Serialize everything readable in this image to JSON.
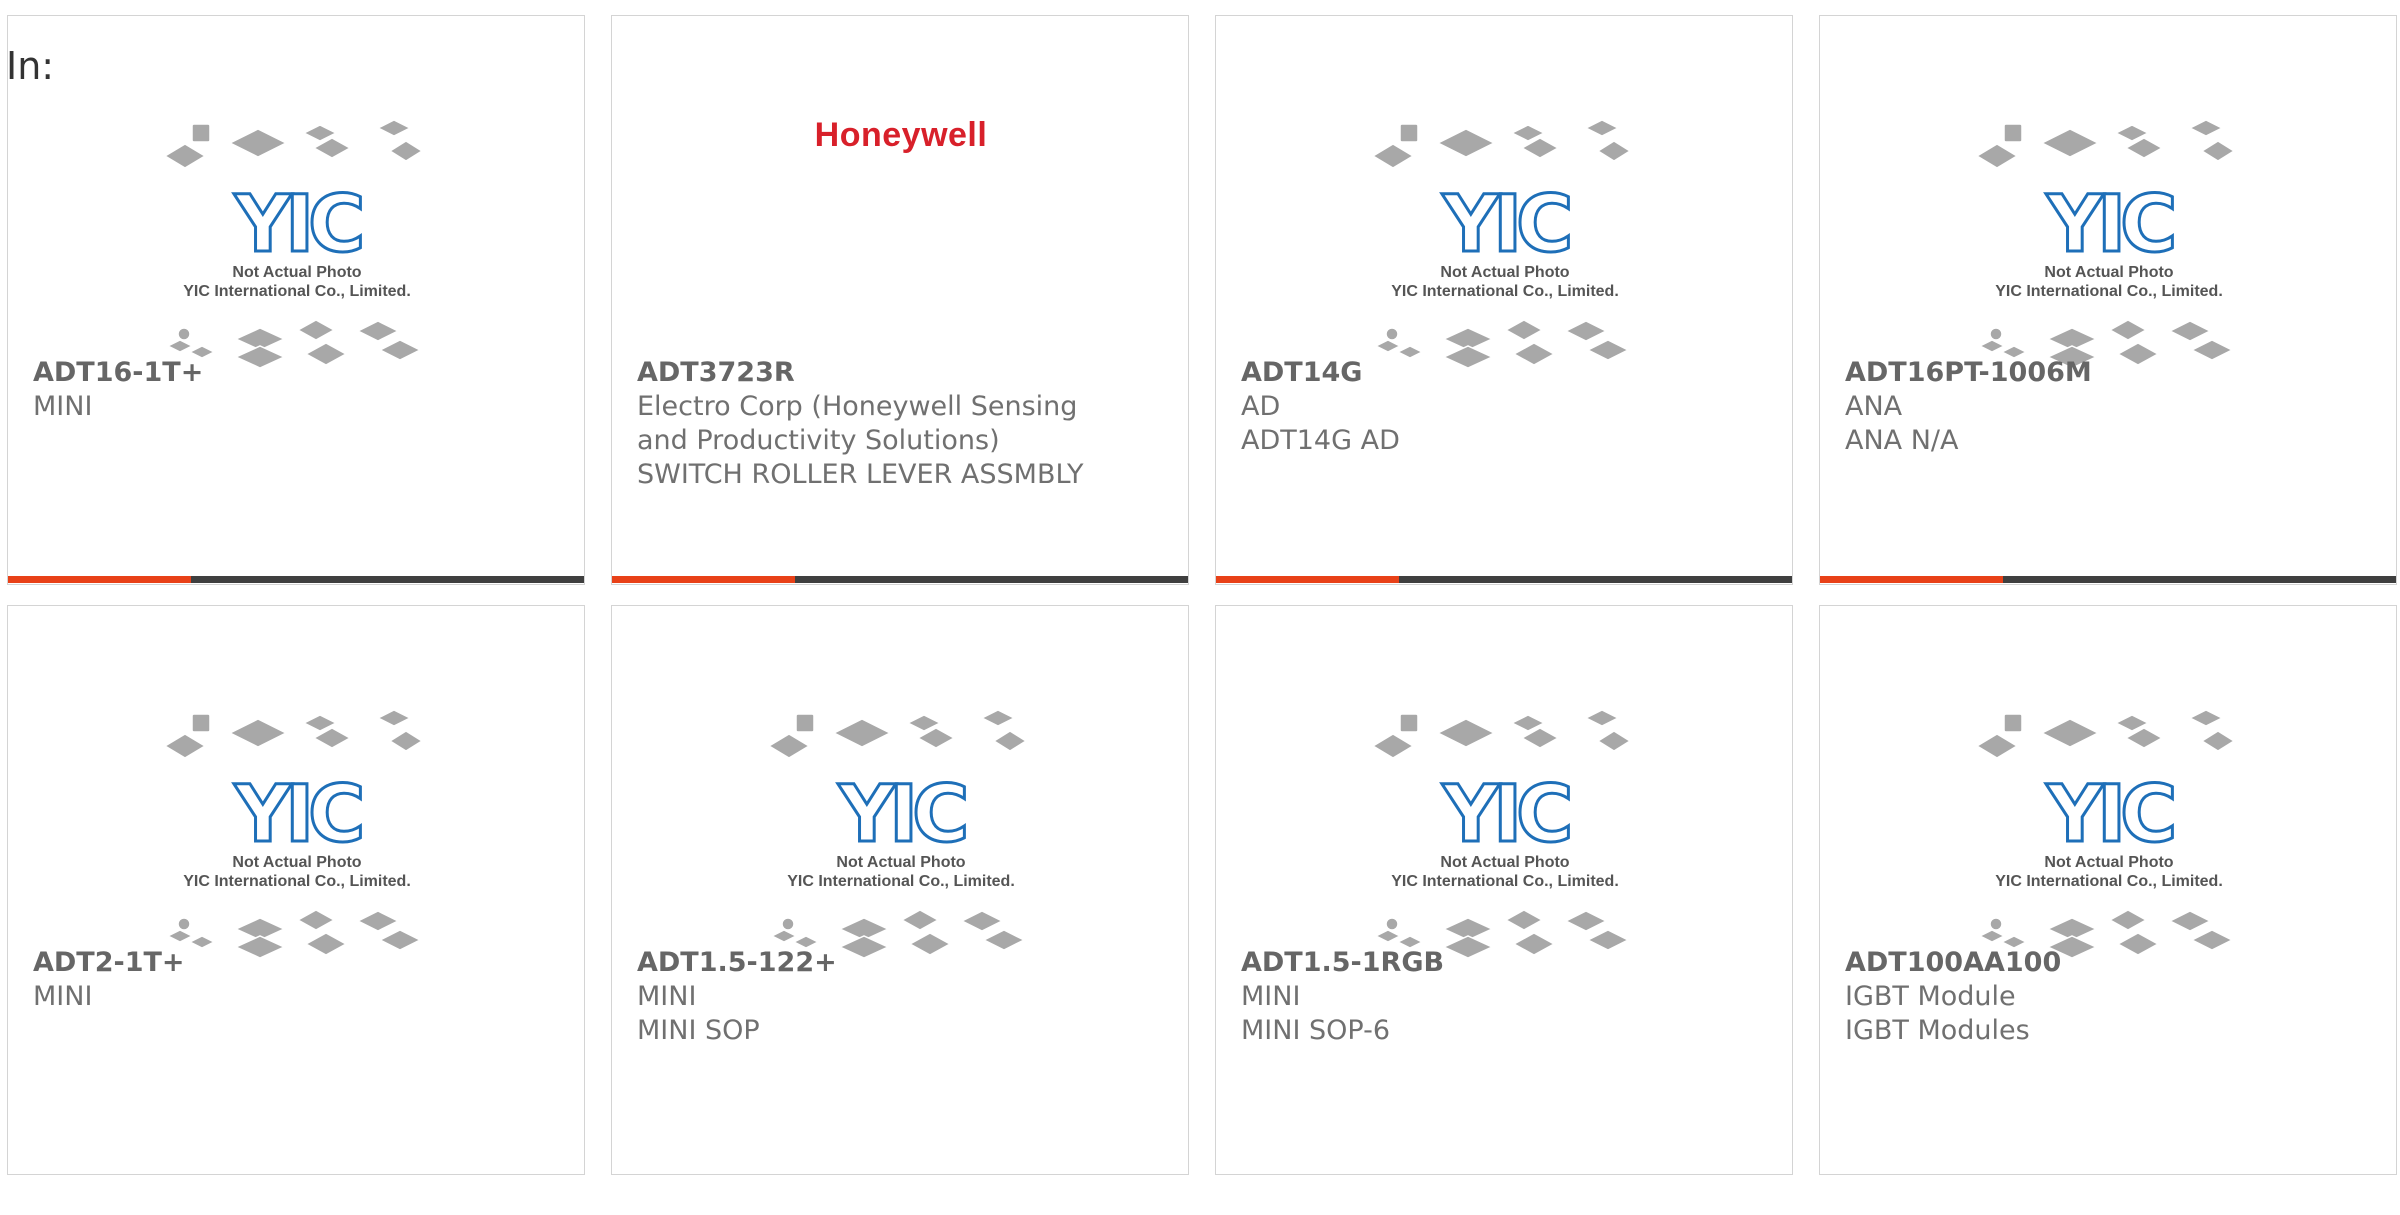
{
  "prefix_label": "In:",
  "placeholder_image": {
    "caption_line1": "Not Actual Photo",
    "caption_line2": "YIC International Co., Limited.",
    "logo_text": "YIC",
    "logo_color": "#1e6fb8",
    "chip_color": "#a8a8a8"
  },
  "accent_color": "#e84118",
  "bar_color": "#3f3f3f",
  "products": [
    {
      "part_number": "ADT16-1T+",
      "lines": [
        "MINI"
      ],
      "image": "placeholder"
    },
    {
      "part_number": "ADT3723R",
      "lines": [
        "Electro Corp (Honeywell Sensing",
        "and Productivity Solutions)",
        "SWITCH ROLLER LEVER ASSMBLY"
      ],
      "image": "honeywell",
      "brand_logo_text": "Honeywell"
    },
    {
      "part_number": "ADT14G",
      "lines": [
        "AD",
        "ADT14G AD"
      ],
      "image": "placeholder"
    },
    {
      "part_number": "ADT16PT-1006M",
      "lines": [
        "ANA",
        "ANA N/A"
      ],
      "image": "placeholder"
    },
    {
      "part_number": "ADT2-1T+",
      "lines": [
        "MINI"
      ],
      "image": "placeholder"
    },
    {
      "part_number": "ADT1.5-122+",
      "lines": [
        "MINI",
        "MINI SOP"
      ],
      "image": "placeholder"
    },
    {
      "part_number": "ADT1.5-1RGB",
      "lines": [
        "MINI",
        "MINI SOP-6"
      ],
      "image": "placeholder"
    },
    {
      "part_number": "ADT100AA100",
      "lines": [
        "IGBT Module",
        "IGBT Modules"
      ],
      "image": "placeholder"
    }
  ]
}
